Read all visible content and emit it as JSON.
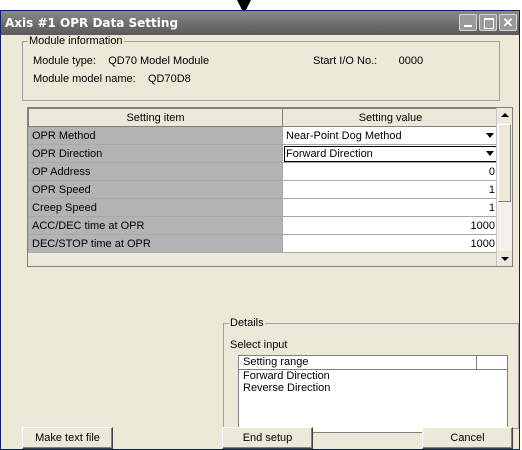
{
  "window": {
    "title": "Axis #1 OPR Data Setting",
    "title_color": "#6b6b6b"
  },
  "module_info": {
    "legend": "Module information",
    "type_label": "Module type:",
    "type_value": "QD70 Model Module",
    "start_io_label": "Start I/O No.:",
    "start_io_value": "0000",
    "model_label": "Module model name:",
    "model_value": "QD70D8"
  },
  "grid": {
    "headers": [
      "Setting item",
      "Setting value"
    ],
    "rows": [
      {
        "item": "OPR Method",
        "value": "Near-Point Dog Method",
        "dropdown": true
      },
      {
        "item": "OPR Direction",
        "value": "Forward Direction",
        "dropdown": true
      },
      {
        "item": "OP Address",
        "value": "0",
        "dropdown": false
      },
      {
        "item": "OPR Speed",
        "value": "1",
        "dropdown": false
      },
      {
        "item": "Creep Speed",
        "value": "1",
        "dropdown": false
      },
      {
        "item": "ACC/DEC time at OPR",
        "value": "1000",
        "dropdown": false
      },
      {
        "item": "DEC/STOP time at OPR",
        "value": "1000",
        "dropdown": false
      }
    ],
    "selected_row": 1
  },
  "details": {
    "legend": "Details",
    "select_label": "Select input",
    "range_header": "Setting range",
    "options": [
      "Forward Direction",
      "Reverse Direction"
    ]
  },
  "buttons": {
    "make_text_file": "Make text file",
    "end_setup": "End setup",
    "cancel": "Cancel"
  },
  "icons": {
    "minimize": "minimize-icon",
    "maximize": "maximize-icon",
    "close": "close-icon"
  }
}
